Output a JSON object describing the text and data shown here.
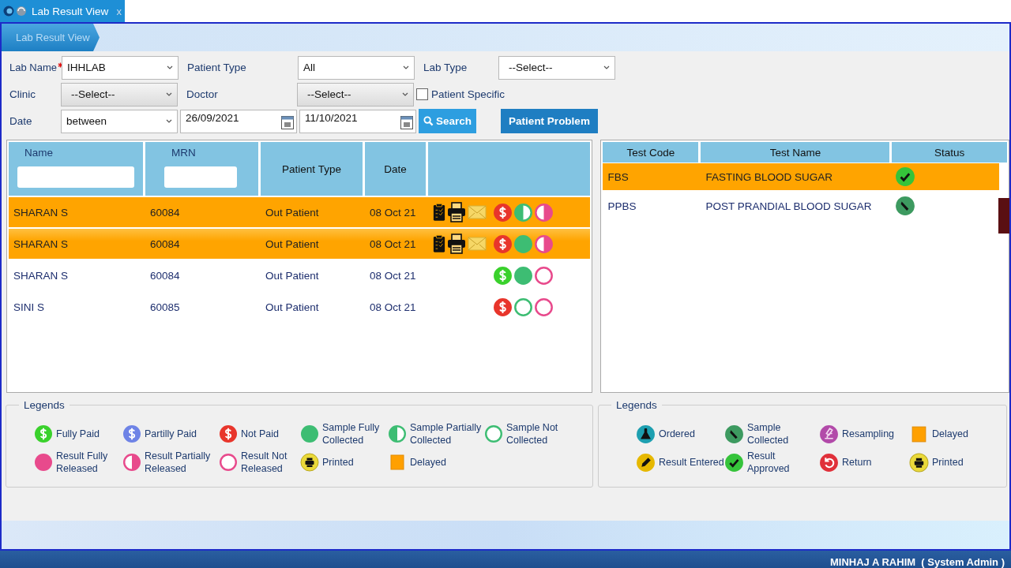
{
  "tab": {
    "title": "Lab Result View",
    "close": "x"
  },
  "breadcrumb": "Lab Result View",
  "filters": {
    "lab_name": {
      "label": "Lab Name",
      "required": true,
      "value": "IHHLAB"
    },
    "patient_type": {
      "label": "Patient Type",
      "value": "All"
    },
    "lab_type": {
      "label": "Lab Type",
      "value": "--Select--"
    },
    "clinic": {
      "label": "Clinic",
      "value": "--Select--"
    },
    "doctor": {
      "label": "Doctor",
      "value": "--Select--"
    },
    "patient_specific": {
      "label": "Patient Specific",
      "checked": false
    },
    "date": {
      "label": "Date",
      "value": "between",
      "from": "26/09/2021",
      "to": "11/10/2021"
    }
  },
  "buttons": {
    "search": "Search",
    "patient_problem": "Patient Problem"
  },
  "patients": {
    "columns": [
      "Name",
      "MRN",
      "Patient Type",
      "Date"
    ],
    "rows": [
      {
        "name": "SHARAN S",
        "mrn": "60084",
        "patient_type": "Out Patient",
        "date": "08 Oct 21",
        "selected": true,
        "hovered": false,
        "actions": true,
        "status_icons": [
          {
            "kind": "not_paid"
          },
          {
            "kind": "sample_partial"
          },
          {
            "kind": "result_partial"
          }
        ]
      },
      {
        "name": "SHARAN S",
        "mrn": "60084",
        "patient_type": "Out Patient",
        "date": "08 Oct 21",
        "selected": true,
        "hovered": true,
        "actions": true,
        "status_icons": [
          {
            "kind": "not_paid"
          },
          {
            "kind": "sample_full"
          },
          {
            "kind": "result_partial"
          }
        ]
      },
      {
        "name": "SHARAN S",
        "mrn": "60084",
        "patient_type": "Out Patient",
        "date": "08 Oct 21",
        "selected": false,
        "hovered": false,
        "actions": false,
        "status_icons": [
          {
            "kind": "fully_paid"
          },
          {
            "kind": "sample_full"
          },
          {
            "kind": "result_none"
          }
        ]
      },
      {
        "name": "SINI S",
        "mrn": "60085",
        "patient_type": "Out Patient",
        "date": "08 Oct 21",
        "selected": false,
        "hovered": false,
        "actions": false,
        "status_icons": [
          {
            "kind": "not_paid"
          },
          {
            "kind": "sample_none"
          },
          {
            "kind": "result_none"
          }
        ]
      }
    ]
  },
  "tests": {
    "columns": [
      "Test Code",
      "Test Name",
      "Status"
    ],
    "rows": [
      {
        "code": "FBS",
        "name": "FASTING BLOOD SUGAR",
        "status_icon": {
          "kind": "approved"
        },
        "selected": true
      },
      {
        "code": "PPBS",
        "name": "POST PRANDIAL BLOOD SUGAR",
        "status_icon": {
          "kind": "collected"
        },
        "selected": false
      }
    ]
  },
  "legends_left": {
    "title": "Legends",
    "items": [
      {
        "kind": "fully_paid",
        "label": "Fully Paid"
      },
      {
        "kind": "partially_paid",
        "label": "Partilly Paid"
      },
      {
        "kind": "not_paid",
        "label": "Not Paid"
      },
      {
        "kind": "sample_full",
        "label": "Sample Fully Collected"
      },
      {
        "kind": "sample_partial",
        "label": "Sample Partially Collected"
      },
      {
        "kind": "sample_none",
        "label": "Sample Not Collected"
      },
      {
        "kind": "result_full",
        "label": "Result Fully Released"
      },
      {
        "kind": "result_partial",
        "label": "Result Partially Released"
      },
      {
        "kind": "result_none",
        "label": "Result Not Released"
      },
      {
        "kind": "printed",
        "label": "Printed"
      },
      {
        "kind": "delayed",
        "label": "Delayed"
      }
    ]
  },
  "legends_right": {
    "title": "Legends",
    "items": [
      {
        "kind": "ordered",
        "label": "Ordered"
      },
      {
        "kind": "collected",
        "label": "Sample Collected"
      },
      {
        "kind": "resampling",
        "label": "Resampling"
      },
      {
        "kind": "delayed",
        "label": "Delayed"
      },
      {
        "kind": "entered",
        "label": "Result Entered"
      },
      {
        "kind": "approved",
        "label": "Result Approved"
      },
      {
        "kind": "return",
        "label": "Return"
      },
      {
        "kind": "printed",
        "label": "Printed"
      }
    ]
  },
  "status_bar": {
    "user": "MINHAJ A RAHIM  ( System Admin )"
  }
}
